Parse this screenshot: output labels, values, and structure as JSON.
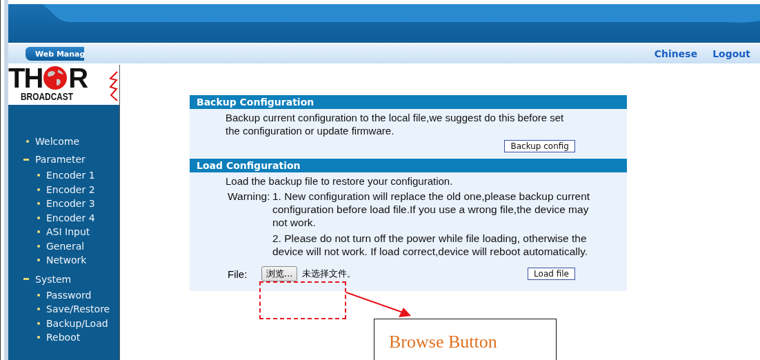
{
  "nav_bar": {
    "tab": "Web Manag",
    "links": [
      {
        "label": "Chinese"
      },
      {
        "label": "Logout"
      }
    ]
  },
  "logo": {
    "left": "TH",
    "right": "R",
    "subtitle": "BROADCAST"
  },
  "sidebar": {
    "items": [
      {
        "label": "Welcome"
      },
      {
        "label": "Parameter",
        "expanded": true,
        "children": [
          {
            "label": "Encoder 1"
          },
          {
            "label": "Encoder 2"
          },
          {
            "label": "Encoder 3"
          },
          {
            "label": "Encoder 4"
          },
          {
            "label": "ASI Input"
          },
          {
            "label": "General"
          },
          {
            "label": "Network"
          }
        ]
      },
      {
        "label": "System",
        "expanded": true,
        "children": [
          {
            "label": "Password"
          },
          {
            "label": "Save/Restore"
          },
          {
            "label": "Backup/Load"
          },
          {
            "label": "Reboot"
          }
        ]
      }
    ]
  },
  "backup": {
    "title": "Backup Configuration",
    "text": "Backup current configuration to the local file,we suggest do this before set the configuration or update firmware.",
    "button": "Backup config"
  },
  "load": {
    "title": "Load Configuration",
    "text": "Load the backup file to restore your configuration.",
    "warning_label": "Warning:",
    "warnings": [
      "1. New configuration will replace the old one,please backup current configuration before load file.If you use a wrong file,the device may not work.",
      "2. Please do not turn off the power while file loading, otherwise the device will not work. If load correct,device will reboot automatically."
    ],
    "file_label": "File:",
    "browse_button": "浏览...",
    "file_status": "未选择文件。",
    "button": "Load file"
  },
  "annotation": {
    "callout": "Browse Button"
  }
}
